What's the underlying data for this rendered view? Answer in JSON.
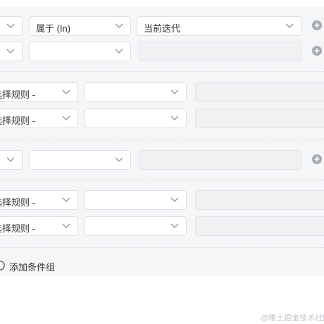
{
  "rows": {
    "r1": {
      "operator": "属于 (In)",
      "value": "当前迭代"
    },
    "r5": {
      "field": "选择规则 -"
    },
    "r6": {
      "field": "选择规则 -"
    },
    "r8": {
      "field": "选择规则 -"
    },
    "r9": {
      "field": "选择规则 -"
    }
  },
  "footer": {
    "add_group_label": "添加条件组"
  },
  "watermark": "@稀土掘金技术社区",
  "colors": {
    "icon": "#a7abb3",
    "border": "#dcdfe6",
    "disabled_bg": "#f0f1f3"
  }
}
